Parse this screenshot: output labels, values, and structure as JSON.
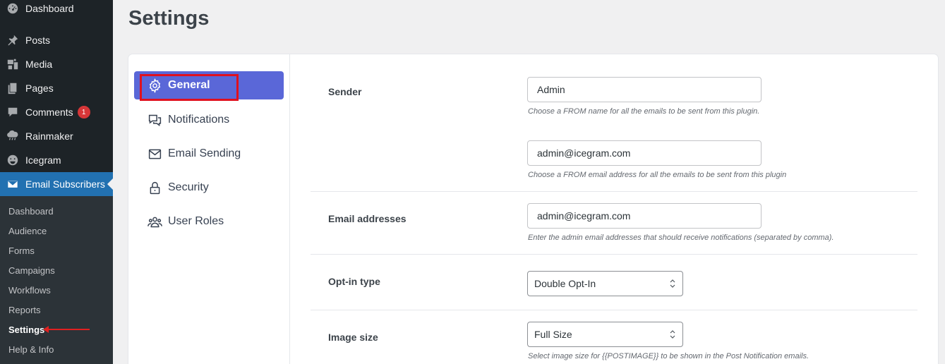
{
  "admin_menu": {
    "items": [
      {
        "label": "Dashboard",
        "icon": "dashboard-icon"
      },
      {
        "label": "Posts",
        "icon": "pin-icon"
      },
      {
        "label": "Media",
        "icon": "media-icon"
      },
      {
        "label": "Pages",
        "icon": "pages-icon"
      },
      {
        "label": "Comments",
        "icon": "comment-icon",
        "badge": "1"
      },
      {
        "label": "Rainmaker",
        "icon": "cloud-icon"
      },
      {
        "label": "Icegram",
        "icon": "icegram-icon"
      },
      {
        "label": "Email Subscribers",
        "icon": "email-icon",
        "current": true
      }
    ],
    "submenu": [
      "Dashboard",
      "Audience",
      "Forms",
      "Campaigns",
      "Workflows",
      "Reports",
      "Settings",
      "Help & Info"
    ],
    "submenu_current": "Settings"
  },
  "page": {
    "title": "Settings"
  },
  "tabs": [
    {
      "label": "General",
      "icon": "gear-icon",
      "active": true
    },
    {
      "label": "Notifications",
      "icon": "chat-icon"
    },
    {
      "label": "Email Sending",
      "icon": "envelope-icon"
    },
    {
      "label": "Security",
      "icon": "lock-icon"
    },
    {
      "label": "User Roles",
      "icon": "users-icon"
    }
  ],
  "settings": {
    "sender": {
      "label": "Sender",
      "name_value": "Admin",
      "name_help": "Choose a FROM name for all the emails to be sent from this plugin.",
      "email_value": "admin@icegram.com",
      "email_help": "Choose a FROM email address for all the emails to be sent from this plugin"
    },
    "email_addresses": {
      "label": "Email addresses",
      "value": "admin@icegram.com",
      "help": "Enter the admin email addresses that should receive notifications (separated by comma)."
    },
    "optin": {
      "label": "Opt-in type",
      "value": "Double Opt-In"
    },
    "image_size": {
      "label": "Image size",
      "value": "Full Size",
      "help": "Select image size for {{POSTIMAGE}} to be shown in the Post Notification emails."
    }
  },
  "colors": {
    "admin_bg": "#1d2327",
    "admin_current": "#2271b1",
    "tab_active": "#5a67d8",
    "highlight": "#e0101e"
  }
}
